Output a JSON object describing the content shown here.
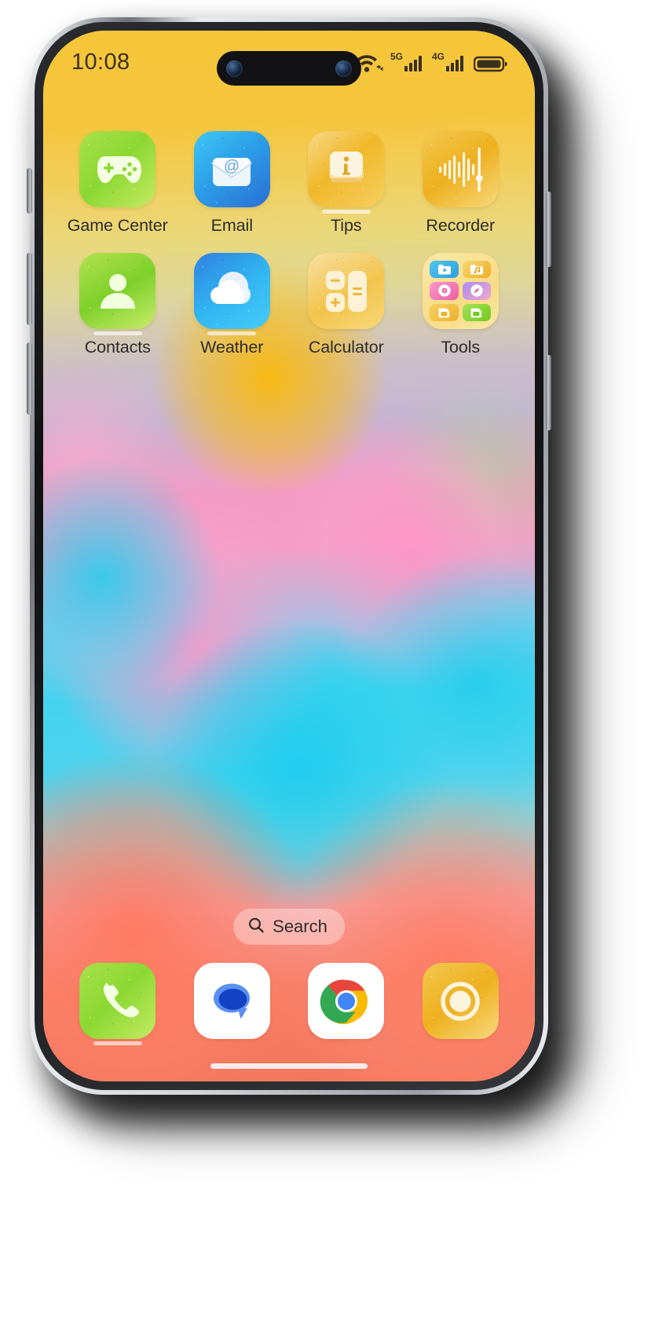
{
  "device": {
    "frame": "smartphone",
    "screen_label": "home-screen"
  },
  "status_bar": {
    "time": "10:08",
    "icons": [
      {
        "name": "wifi-icon",
        "label": "Wi-Fi"
      },
      {
        "name": "signal-5g-icon",
        "label": "5G"
      },
      {
        "name": "signal-4g-icon",
        "label": "4G"
      },
      {
        "name": "battery-icon",
        "label": "Battery"
      }
    ],
    "network_5g_label": "5G",
    "network_4g_label": "4G"
  },
  "home": {
    "rows": [
      [
        {
          "label": "Game Center",
          "icon": "game-center-icon",
          "color": "#8cd832"
        },
        {
          "label": "Email",
          "icon": "email-icon",
          "color": "#2c9fe8"
        },
        {
          "label": "Tips",
          "icon": "tips-icon",
          "color": "#f0b829"
        },
        {
          "label": "Recorder",
          "icon": "recorder-icon",
          "color": "#eeb01f"
        }
      ],
      [
        {
          "label": "Contacts",
          "icon": "contacts-icon",
          "color": "#7ed02a"
        },
        {
          "label": "Weather",
          "icon": "weather-icon",
          "color": "#31b6f2"
        },
        {
          "label": "Calculator",
          "icon": "calculator-icon",
          "color": "#f2c44c"
        },
        {
          "label": "Tools",
          "icon": "tools-folder-icon",
          "color": "#f7dc86"
        }
      ]
    ],
    "folder": {
      "name": "Tools",
      "apps": [
        {
          "name": "video-icon",
          "color": "#38b6ef"
        },
        {
          "name": "music-icon",
          "color": "#f5b93c"
        },
        {
          "name": "music-player-icon",
          "color": "#f27bb0"
        },
        {
          "name": "compass-icon",
          "color": "#9a7ee8"
        },
        {
          "name": "sim-card-1-icon",
          "color": "#f3c84e"
        },
        {
          "name": "sim-card-2-icon",
          "color": "#7ed02a"
        }
      ]
    }
  },
  "search": {
    "label": "Search",
    "icon": "search-icon"
  },
  "dock": {
    "apps": [
      {
        "label": "Phone",
        "icon": "phone-icon",
        "color": "#8cd832"
      },
      {
        "label": "Messages",
        "icon": "messages-icon",
        "color": "#1a73e8"
      },
      {
        "label": "Chrome",
        "icon": "chrome-icon",
        "color": "#4285f4"
      },
      {
        "label": "Camera",
        "icon": "camera-icon",
        "color": "#f0b829"
      }
    ]
  },
  "colors": {
    "wallpaper_gold": "#f6c63a",
    "wallpaper_pink": "#f59cc6",
    "wallpaper_cyan": "#43d3ef",
    "wallpaper_coral": "#f4765e",
    "status_text": "#3a3020",
    "label_text": "#2c2c2c"
  }
}
